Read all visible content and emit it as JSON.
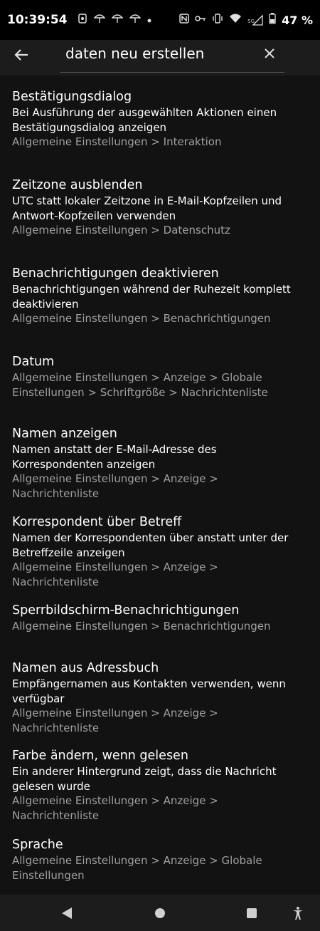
{
  "status_bar": {
    "time": "10:39:54",
    "left_icons": [
      "app-notification-icon",
      "umbrella-icon",
      "umbrella-icon",
      "umbrella-icon",
      "dot-icon"
    ],
    "right_icons": [
      "nfc-icon",
      "key-icon",
      "vibrate-icon",
      "wifi-icon",
      "signal-5g-icon",
      "battery-icon"
    ],
    "signal_label": "5G",
    "battery": "47 %"
  },
  "search": {
    "query": "daten neu erstellen"
  },
  "results": [
    {
      "title": "Bestätigungsdialog",
      "summary": [
        "Bei Ausführung der ausgewählten Aktionen einen",
        "Bestätigungsdialog anzeigen"
      ],
      "path": [
        "Allgemeine Einstellungen > Interaktion"
      ]
    },
    {
      "title": "Zeitzone ausblenden",
      "summary": [
        "UTC statt lokaler Zeitzone in E-Mail-Kopfzeilen und",
        "Antwort-Kopfzeilen verwenden"
      ],
      "path": [
        "Allgemeine Einstellungen > Datenschutz"
      ]
    },
    {
      "title": "Benachrichtigungen deaktivieren",
      "summary": [
        "Benachrichtigungen während der Ruhezeit komplett",
        "deaktivieren"
      ],
      "path": [
        "Allgemeine Einstellungen > Benachrichtigungen"
      ]
    },
    {
      "title": "Datum",
      "summary": [],
      "path": [
        "Allgemeine Einstellungen > Anzeige > Globale",
        "Einstellungen > Schriftgröße > Nachrichtenliste"
      ]
    },
    {
      "title": "Namen anzeigen",
      "summary": [
        "Namen anstatt der E-Mail-Adresse des",
        "Korrespondenten anzeigen"
      ],
      "path": [
        "Allgemeine Einstellungen > Anzeige > Nachrichtenliste"
      ]
    },
    {
      "title": "Korrespondent über Betreff",
      "summary": [
        "Namen der Korrespondenten über anstatt unter der",
        "Betreffzeile anzeigen"
      ],
      "path": [
        "Allgemeine Einstellungen > Anzeige > Nachrichtenliste"
      ]
    },
    {
      "title": "Sperrbildschirm-Benachrichtigungen",
      "summary": [],
      "path": [
        "Allgemeine Einstellungen > Benachrichtigungen"
      ]
    },
    {
      "title": "Namen aus Adressbuch",
      "summary": [
        "Empfängernamen aus Kontakten verwenden, wenn",
        "verfügbar"
      ],
      "path": [
        "Allgemeine Einstellungen > Anzeige > Nachrichtenliste"
      ]
    },
    {
      "title": "Farbe ändern, wenn gelesen",
      "summary": [
        "Ein anderer Hintergrund zeigt, dass die Nachricht",
        "gelesen wurde"
      ],
      "path": [
        "Allgemeine Einstellungen > Anzeige > Nachrichtenliste"
      ]
    },
    {
      "title": "Sprache",
      "summary": [],
      "path": [
        "Allgemeine Einstellungen > Anzeige > Globale",
        "Einstellungen"
      ]
    }
  ],
  "nav_bar": {
    "icons": [
      "back-triangle-icon",
      "home-circle-icon",
      "recents-square-icon",
      "accessibility-icon"
    ]
  }
}
